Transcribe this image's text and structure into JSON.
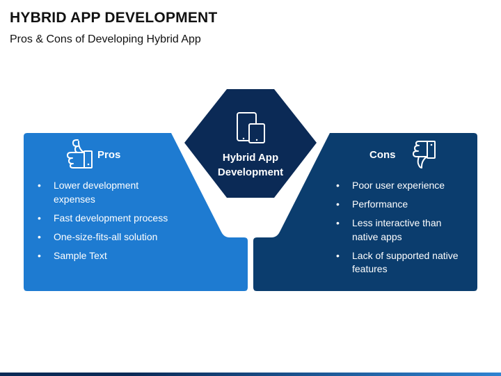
{
  "title": "HYBRID APP DEVELOPMENT",
  "subtitle": "Pros & Cons of Developing Hybrid App",
  "center": {
    "label_line1": "Hybrid App",
    "label_line2": "Development",
    "icon": "mobile-tablet-icon"
  },
  "pros": {
    "title": "Pros",
    "icon": "thumbs-up-icon",
    "color": "#1e7bd1",
    "items": [
      "Lower development expenses",
      "Fast development process",
      "One-size-fits-all solution",
      "Sample Text"
    ]
  },
  "cons": {
    "title": "Cons",
    "icon": "thumbs-down-icon",
    "color": "#0b3d6e",
    "items": [
      "Poor user experience",
      "Performance",
      "Less interactive than native apps",
      "Lack of supported native features"
    ]
  },
  "colors": {
    "hexagon": "#0b2a56",
    "hexagon_border": "#ffffff"
  }
}
